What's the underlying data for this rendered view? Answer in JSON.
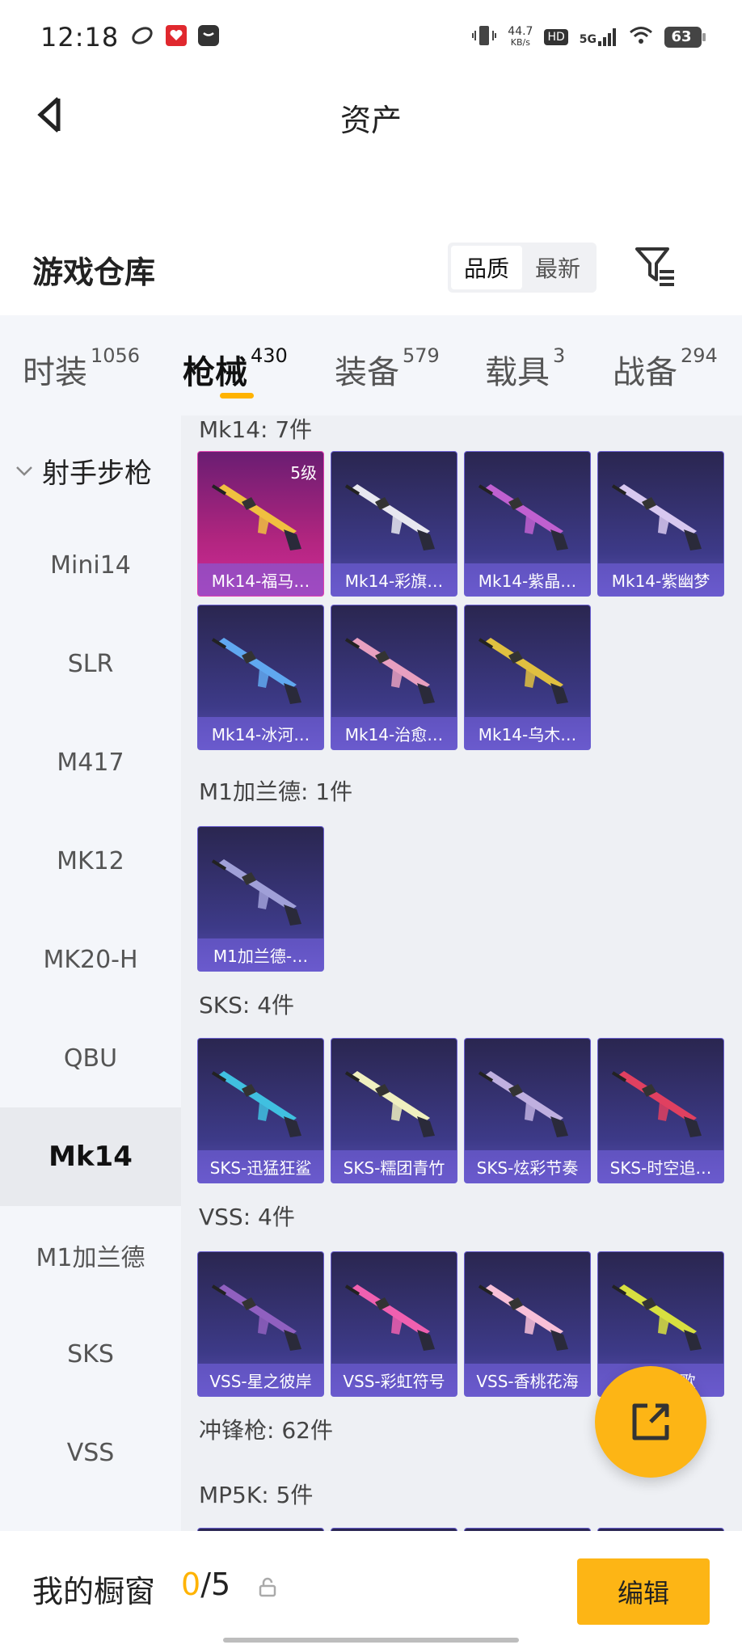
{
  "status": {
    "time": "12:18",
    "net_speed": "44.7",
    "net_unit": "KB/s",
    "hd": "HD",
    "signal": "5G",
    "battery": "63"
  },
  "header": {
    "title": "资产"
  },
  "warehouse": {
    "title": "游戏仓库",
    "sort": {
      "quality": "品质",
      "newest": "最新"
    }
  },
  "tabs": [
    {
      "label": "时装",
      "count": "1056"
    },
    {
      "label": "枪械",
      "count": "430"
    },
    {
      "label": "装备",
      "count": "579"
    },
    {
      "label": "载具",
      "count": "3"
    },
    {
      "label": "战备",
      "count": "294"
    }
  ],
  "sidebar": {
    "category": "射手步枪",
    "items": [
      "Mini14",
      "SLR",
      "M417",
      "MK12",
      "MK20-H",
      "QBU",
      "Mk14",
      "M1加兰德",
      "SKS",
      "VSS"
    ]
  },
  "sections": [
    {
      "title": "Mk14: 7件",
      "items": [
        {
          "name": "Mk14-福马…",
          "level": "5级",
          "color": "#f0c040",
          "gold": true
        },
        {
          "name": "Mk14-彩旗…",
          "color": "#e8e8f0"
        },
        {
          "name": "Mk14-紫晶…",
          "color": "#c060d0"
        },
        {
          "name": "Mk14-紫幽梦",
          "color": "#d8c8f0"
        },
        {
          "name": "Mk14-冰河…",
          "color": "#60a8f0"
        },
        {
          "name": "Mk14-治愈…",
          "color": "#e8a0c0"
        },
        {
          "name": "Mk14-乌木…",
          "color": "#e0c040"
        }
      ]
    },
    {
      "title": "M1加兰德: 1件",
      "items": [
        {
          "name": "M1加兰德-…",
          "color": "#a0a0d8"
        }
      ]
    },
    {
      "title": "SKS: 4件",
      "items": [
        {
          "name": "SKS-迅猛狂鲨",
          "color": "#40c0e0"
        },
        {
          "name": "SKS-糯团青竹",
          "color": "#f0f0c0"
        },
        {
          "name": "SKS-炫彩节奏",
          "color": "#c0b0e0"
        },
        {
          "name": "SKS-时空追…",
          "color": "#e04060"
        }
      ]
    },
    {
      "title": "VSS: 4件",
      "items": [
        {
          "name": "VSS-星之彼岸",
          "color": "#9060c0"
        },
        {
          "name": "VSS-彩虹符号",
          "color": "#f060b0"
        },
        {
          "name": "VSS-香桃花海",
          "color": "#f8c0d8"
        },
        {
          "name": "VSS-牧歌",
          "color": "#d8e040"
        }
      ]
    }
  ],
  "smg_header": "冲锋枪: 62件",
  "mp5k_header": "MP5K: 5件",
  "bottom": {
    "label": "我的橱窗",
    "used": "0",
    "total": "/5",
    "edit": "编辑"
  }
}
